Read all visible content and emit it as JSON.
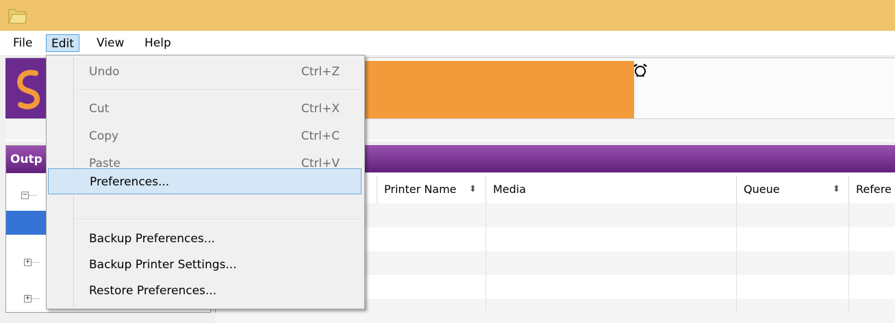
{
  "menubar": {
    "items": [
      {
        "label": "File"
      },
      {
        "label": "Edit"
      },
      {
        "label": "View"
      },
      {
        "label": "Help"
      }
    ]
  },
  "left_panel": {
    "header": "Outp"
  },
  "grid": {
    "columns": [
      {
        "label": "Printer Name",
        "sort_icon": "sort-updown-icon"
      },
      {
        "label": "Media"
      },
      {
        "label": "Queue",
        "sort_icon": "sort-updown-icon"
      },
      {
        "label": "Refere"
      }
    ]
  },
  "edit_menu": {
    "items": [
      {
        "label": "Undo",
        "shortcut": "Ctrl+Z",
        "enabled": false
      },
      {
        "label": "Cut",
        "shortcut": "Ctrl+X",
        "enabled": false
      },
      {
        "label": "Copy",
        "shortcut": "Ctrl+C",
        "enabled": false
      },
      {
        "label": "Paste",
        "shortcut": "Ctrl+V",
        "enabled": false
      },
      {
        "label": "Preferences...",
        "shortcut": "",
        "enabled": true,
        "highlighted": true
      },
      {
        "label": "Backup Preferences...",
        "shortcut": "",
        "enabled": true
      },
      {
        "label": "Backup Printer Settings...",
        "shortcut": "",
        "enabled": true
      },
      {
        "label": "Restore Preferences...",
        "shortcut": "",
        "enabled": true
      }
    ]
  },
  "colors": {
    "titlebar": "#f0c46a",
    "banner_orange": "#f39a3b",
    "logo_purple": "#6b2a8e",
    "panel_header_purple": "#7a3393",
    "selection_blue": "#3574d4",
    "menu_highlight": "#d5e6f6"
  },
  "icons": {
    "app": "app-folder-icon",
    "alarm": "alarm-clock-icon",
    "logo": "swirl-logo-icon"
  }
}
